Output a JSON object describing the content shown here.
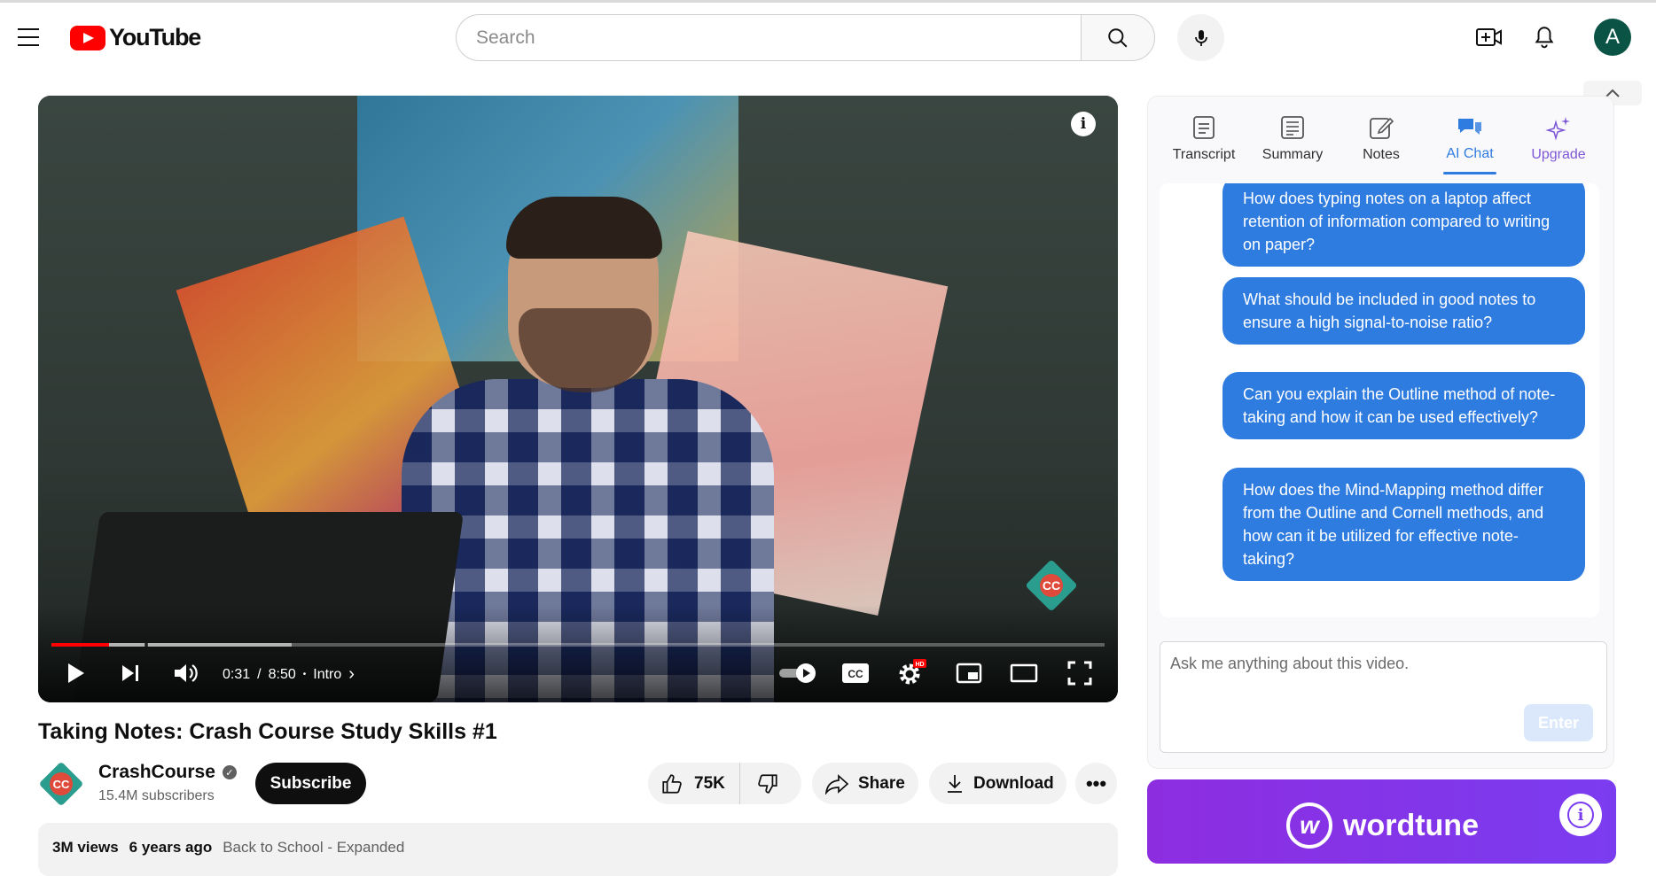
{
  "header": {
    "logo_text": "YouTube",
    "search_placeholder": "Search",
    "avatar_letter": "A"
  },
  "player": {
    "time_current": "0:31",
    "time_total": "8:50",
    "time_separator": "/",
    "chapter": "Intro",
    "progress_played_fraction": 0.055,
    "progress_buffered_fraction": 0.228,
    "badge_text": "CC",
    "settings_badge": "HD",
    "cc_label": "CC"
  },
  "video": {
    "title": "Taking Notes: Crash Course Study Skills #1",
    "channel_name": "CrashCourse",
    "subscribers": "15.4M subscribers",
    "subscribe_label": "Subscribe",
    "likes": "75K",
    "share_label": "Share",
    "download_label": "Download",
    "views": "3M views",
    "age": "6 years ago",
    "playlist": "Back to School - Expanded"
  },
  "panel": {
    "tabs": [
      {
        "label": "Transcript",
        "icon": "transcript-icon"
      },
      {
        "label": "Summary",
        "icon": "summary-icon"
      },
      {
        "label": "Notes",
        "icon": "notes-icon"
      },
      {
        "label": "AI Chat",
        "icon": "chat-icon",
        "active": true
      },
      {
        "label": "Upgrade",
        "icon": "sparkle-icon"
      }
    ],
    "messages": [
      "How does typing notes on a laptop affect retention of information compared to writing on paper?",
      "What should be included in good notes to ensure a high signal-to-noise ratio?",
      "Can you explain the Outline method of note-taking and how it can be used effectively?",
      "How does the Mind-Mapping method differ from the Outline and Cornell methods, and how can it be utilized for effective note-taking?"
    ],
    "input_placeholder": "Ask me anything about this video.",
    "enter_label": "Enter"
  },
  "ad": {
    "brand": "wordtune",
    "mark": "w"
  },
  "colors": {
    "accent_blue": "#2f7ce0",
    "youtube_red": "#ff0000",
    "wordtune_purple": "#7b3cf0"
  }
}
